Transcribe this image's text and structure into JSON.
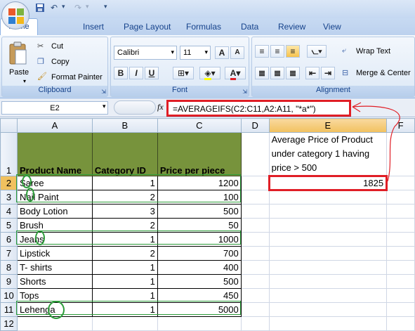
{
  "ribbon_tabs": [
    "Home",
    "Insert",
    "Page Layout",
    "Formulas",
    "Data",
    "Review",
    "View"
  ],
  "clipboard": {
    "paste": "Paste",
    "cut": "Cut",
    "copy": "Copy",
    "format_painter": "Format Painter",
    "label": "Clipboard"
  },
  "font": {
    "name": "Calibri",
    "size": "11",
    "label": "Font",
    "grow": "A",
    "shrink": "A",
    "bold": "B",
    "italic": "I",
    "underline": "U",
    "color_letter": "A"
  },
  "alignment": {
    "wrap": "Wrap Text",
    "merge": "Merge & Center",
    "label": "Alignment"
  },
  "formula_bar": {
    "name_box": "E2",
    "fx": "fx",
    "formula": "=AVERAGEIFS(C2:C11,A2:A11, \"*a*\")"
  },
  "columns": [
    "A",
    "B",
    "C",
    "D",
    "E",
    "F"
  ],
  "rows": [
    "1",
    "2",
    "3",
    "4",
    "5",
    "6",
    "7",
    "8",
    "9",
    "10",
    "11",
    "12"
  ],
  "headers": [
    "Product Name",
    "Category ID",
    "Price per piece"
  ],
  "data": [
    {
      "name": "Saree",
      "cat": "1",
      "price": "1200"
    },
    {
      "name": "Nail Paint",
      "cat": "2",
      "price": "100"
    },
    {
      "name": "Body Lotion",
      "cat": "3",
      "price": "500"
    },
    {
      "name": "Brush",
      "cat": "2",
      "price": "50"
    },
    {
      "name": "Jeans",
      "cat": "1",
      "price": "1000"
    },
    {
      "name": "Lipstick",
      "cat": "2",
      "price": "700"
    },
    {
      "name": "T- shirts",
      "cat": "1",
      "price": "400"
    },
    {
      "name": "Shorts",
      "cat": "1",
      "price": "500"
    },
    {
      "name": "Tops",
      "cat": "1",
      "price": "450"
    },
    {
      "name": "Lehenga",
      "cat": "1",
      "price": "5000"
    }
  ],
  "note": [
    "Average Price of  Product",
    "under category 1 having",
    "price > 500"
  ],
  "result": "1825",
  "colors": {
    "header_fill": "#77933c",
    "highlight_red": "#e01e26",
    "annotation_green": "#2d9c3a"
  }
}
